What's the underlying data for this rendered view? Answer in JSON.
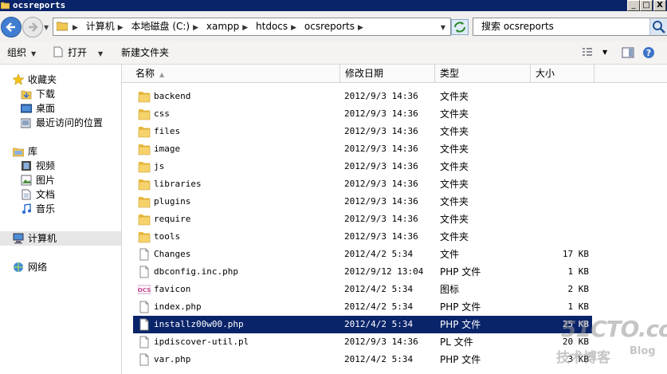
{
  "window": {
    "title": "ocsreports",
    "minimize": "_",
    "maximize": "□",
    "close": "X"
  },
  "address": {
    "crumbs": [
      "计算机",
      "本地磁盘 (C:)",
      "xampp",
      "htdocs",
      "ocsreports"
    ],
    "search_text": "搜索 ocsreports"
  },
  "toolbar": {
    "organize": "组织",
    "open": "打开",
    "new_folder": "新建文件夹"
  },
  "sidebar": {
    "favorites": "收藏夹",
    "favorites_items": [
      "下载",
      "桌面",
      "最近访问的位置"
    ],
    "libraries": "库",
    "library_items": [
      "视频",
      "图片",
      "文档",
      "音乐"
    ],
    "computer": "计算机",
    "network": "网络"
  },
  "columns": {
    "name": "名称",
    "date": "修改日期",
    "type": "类型",
    "size": "大小"
  },
  "files": [
    {
      "name": "backend",
      "date": "2012/9/3 14:36",
      "type": "文件夹",
      "size": "",
      "kind": "folder"
    },
    {
      "name": "css",
      "date": "2012/9/3 14:36",
      "type": "文件夹",
      "size": "",
      "kind": "folder"
    },
    {
      "name": "files",
      "date": "2012/9/3 14:36",
      "type": "文件夹",
      "size": "",
      "kind": "folder"
    },
    {
      "name": "image",
      "date": "2012/9/3 14:36",
      "type": "文件夹",
      "size": "",
      "kind": "folder"
    },
    {
      "name": "js",
      "date": "2012/9/3 14:36",
      "type": "文件夹",
      "size": "",
      "kind": "folder"
    },
    {
      "name": "libraries",
      "date": "2012/9/3 14:36",
      "type": "文件夹",
      "size": "",
      "kind": "folder"
    },
    {
      "name": "plugins",
      "date": "2012/9/3 14:36",
      "type": "文件夹",
      "size": "",
      "kind": "folder"
    },
    {
      "name": "require",
      "date": "2012/9/3 14:36",
      "type": "文件夹",
      "size": "",
      "kind": "folder"
    },
    {
      "name": "tools",
      "date": "2012/9/3 14:36",
      "type": "文件夹",
      "size": "",
      "kind": "folder"
    },
    {
      "name": "Changes",
      "date": "2012/4/2 5:34",
      "type": "文件",
      "size": "17 KB",
      "kind": "file"
    },
    {
      "name": "dbconfig.inc.php",
      "date": "2012/9/12 13:04",
      "type": "PHP 文件",
      "size": "1 KB",
      "kind": "file"
    },
    {
      "name": "favicon",
      "date": "2012/4/2 5:34",
      "type": "图标",
      "size": "2 KB",
      "kind": "ocs"
    },
    {
      "name": "index.php",
      "date": "2012/4/2 5:34",
      "type": "PHP 文件",
      "size": "1 KB",
      "kind": "file"
    },
    {
      "name": "installz00w00.php",
      "date": "2012/4/2 5:34",
      "type": "PHP 文件",
      "size": "25 KB",
      "kind": "file",
      "selected": true
    },
    {
      "name": "ipdiscover-util.pl",
      "date": "2012/9/3 14:36",
      "type": "PL 文件",
      "size": "20 KB",
      "kind": "file"
    },
    {
      "name": "var.php",
      "date": "2012/4/2 5:34",
      "type": "PHP 文件",
      "size": "3 KB",
      "kind": "file"
    }
  ],
  "watermark": {
    "main": "51CTO.com",
    "sub": "技术博客",
    "blog": "Blog"
  }
}
